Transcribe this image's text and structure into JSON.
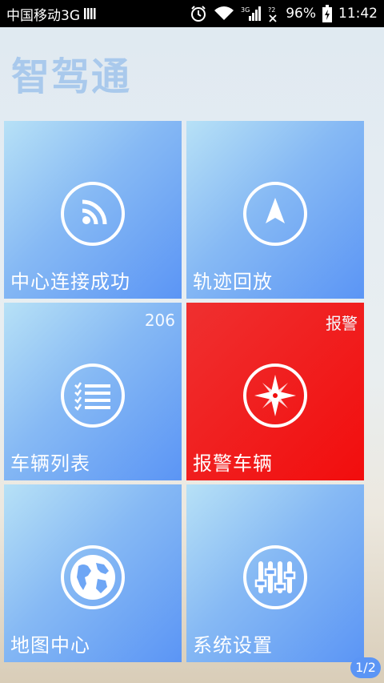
{
  "status_bar": {
    "carrier": "中国移动3G",
    "battery": "96%",
    "time": "11:42"
  },
  "app": {
    "title": "智驾通"
  },
  "tiles": [
    {
      "label": "中心连接成功",
      "badge": "",
      "icon": "rss-icon"
    },
    {
      "label": "轨迹回放",
      "badge": "",
      "icon": "navigation-arrow-icon"
    },
    {
      "label": "车辆列表",
      "badge": "206",
      "icon": "list-icon"
    },
    {
      "label": "报警车辆",
      "badge": "报警",
      "icon": "compass-star-icon"
    },
    {
      "label": "地图中心",
      "badge": "",
      "icon": "globe-icon"
    },
    {
      "label": "系统设置",
      "badge": "",
      "icon": "sliders-icon"
    }
  ],
  "pager": {
    "text": "1/2"
  },
  "colors": {
    "tile_blue": "#6ea6f5",
    "tile_alarm": "#f20d0d",
    "title_color": "#a9c9ec"
  }
}
